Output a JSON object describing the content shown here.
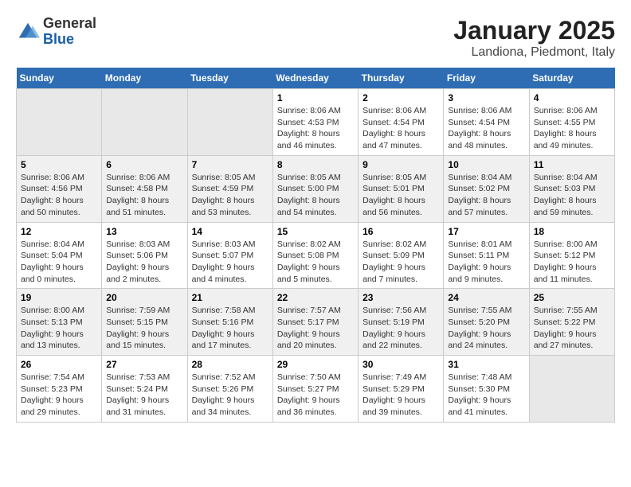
{
  "header": {
    "logo": {
      "general": "General",
      "blue": "Blue"
    },
    "title": "January 2025",
    "subtitle": "Landiona, Piedmont, Italy"
  },
  "weekdays": [
    "Sunday",
    "Monday",
    "Tuesday",
    "Wednesday",
    "Thursday",
    "Friday",
    "Saturday"
  ],
  "weeks": [
    [
      {
        "day": "",
        "info": ""
      },
      {
        "day": "",
        "info": ""
      },
      {
        "day": "",
        "info": ""
      },
      {
        "day": "1",
        "info": "Sunrise: 8:06 AM\nSunset: 4:53 PM\nDaylight: 8 hours\nand 46 minutes."
      },
      {
        "day": "2",
        "info": "Sunrise: 8:06 AM\nSunset: 4:54 PM\nDaylight: 8 hours\nand 47 minutes."
      },
      {
        "day": "3",
        "info": "Sunrise: 8:06 AM\nSunset: 4:54 PM\nDaylight: 8 hours\nand 48 minutes."
      },
      {
        "day": "4",
        "info": "Sunrise: 8:06 AM\nSunset: 4:55 PM\nDaylight: 8 hours\nand 49 minutes."
      }
    ],
    [
      {
        "day": "5",
        "info": "Sunrise: 8:06 AM\nSunset: 4:56 PM\nDaylight: 8 hours\nand 50 minutes."
      },
      {
        "day": "6",
        "info": "Sunrise: 8:06 AM\nSunset: 4:58 PM\nDaylight: 8 hours\nand 51 minutes."
      },
      {
        "day": "7",
        "info": "Sunrise: 8:05 AM\nSunset: 4:59 PM\nDaylight: 8 hours\nand 53 minutes."
      },
      {
        "day": "8",
        "info": "Sunrise: 8:05 AM\nSunset: 5:00 PM\nDaylight: 8 hours\nand 54 minutes."
      },
      {
        "day": "9",
        "info": "Sunrise: 8:05 AM\nSunset: 5:01 PM\nDaylight: 8 hours\nand 56 minutes."
      },
      {
        "day": "10",
        "info": "Sunrise: 8:04 AM\nSunset: 5:02 PM\nDaylight: 8 hours\nand 57 minutes."
      },
      {
        "day": "11",
        "info": "Sunrise: 8:04 AM\nSunset: 5:03 PM\nDaylight: 8 hours\nand 59 minutes."
      }
    ],
    [
      {
        "day": "12",
        "info": "Sunrise: 8:04 AM\nSunset: 5:04 PM\nDaylight: 9 hours\nand 0 minutes."
      },
      {
        "day": "13",
        "info": "Sunrise: 8:03 AM\nSunset: 5:06 PM\nDaylight: 9 hours\nand 2 minutes."
      },
      {
        "day": "14",
        "info": "Sunrise: 8:03 AM\nSunset: 5:07 PM\nDaylight: 9 hours\nand 4 minutes."
      },
      {
        "day": "15",
        "info": "Sunrise: 8:02 AM\nSunset: 5:08 PM\nDaylight: 9 hours\nand 5 minutes."
      },
      {
        "day": "16",
        "info": "Sunrise: 8:02 AM\nSunset: 5:09 PM\nDaylight: 9 hours\nand 7 minutes."
      },
      {
        "day": "17",
        "info": "Sunrise: 8:01 AM\nSunset: 5:11 PM\nDaylight: 9 hours\nand 9 minutes."
      },
      {
        "day": "18",
        "info": "Sunrise: 8:00 AM\nSunset: 5:12 PM\nDaylight: 9 hours\nand 11 minutes."
      }
    ],
    [
      {
        "day": "19",
        "info": "Sunrise: 8:00 AM\nSunset: 5:13 PM\nDaylight: 9 hours\nand 13 minutes."
      },
      {
        "day": "20",
        "info": "Sunrise: 7:59 AM\nSunset: 5:15 PM\nDaylight: 9 hours\nand 15 minutes."
      },
      {
        "day": "21",
        "info": "Sunrise: 7:58 AM\nSunset: 5:16 PM\nDaylight: 9 hours\nand 17 minutes."
      },
      {
        "day": "22",
        "info": "Sunrise: 7:57 AM\nSunset: 5:17 PM\nDaylight: 9 hours\nand 20 minutes."
      },
      {
        "day": "23",
        "info": "Sunrise: 7:56 AM\nSunset: 5:19 PM\nDaylight: 9 hours\nand 22 minutes."
      },
      {
        "day": "24",
        "info": "Sunrise: 7:55 AM\nSunset: 5:20 PM\nDaylight: 9 hours\nand 24 minutes."
      },
      {
        "day": "25",
        "info": "Sunrise: 7:55 AM\nSunset: 5:22 PM\nDaylight: 9 hours\nand 27 minutes."
      }
    ],
    [
      {
        "day": "26",
        "info": "Sunrise: 7:54 AM\nSunset: 5:23 PM\nDaylight: 9 hours\nand 29 minutes."
      },
      {
        "day": "27",
        "info": "Sunrise: 7:53 AM\nSunset: 5:24 PM\nDaylight: 9 hours\nand 31 minutes."
      },
      {
        "day": "28",
        "info": "Sunrise: 7:52 AM\nSunset: 5:26 PM\nDaylight: 9 hours\nand 34 minutes."
      },
      {
        "day": "29",
        "info": "Sunrise: 7:50 AM\nSunset: 5:27 PM\nDaylight: 9 hours\nand 36 minutes."
      },
      {
        "day": "30",
        "info": "Sunrise: 7:49 AM\nSunset: 5:29 PM\nDaylight: 9 hours\nand 39 minutes."
      },
      {
        "day": "31",
        "info": "Sunrise: 7:48 AM\nSunset: 5:30 PM\nDaylight: 9 hours\nand 41 minutes."
      },
      {
        "day": "",
        "info": ""
      }
    ]
  ]
}
